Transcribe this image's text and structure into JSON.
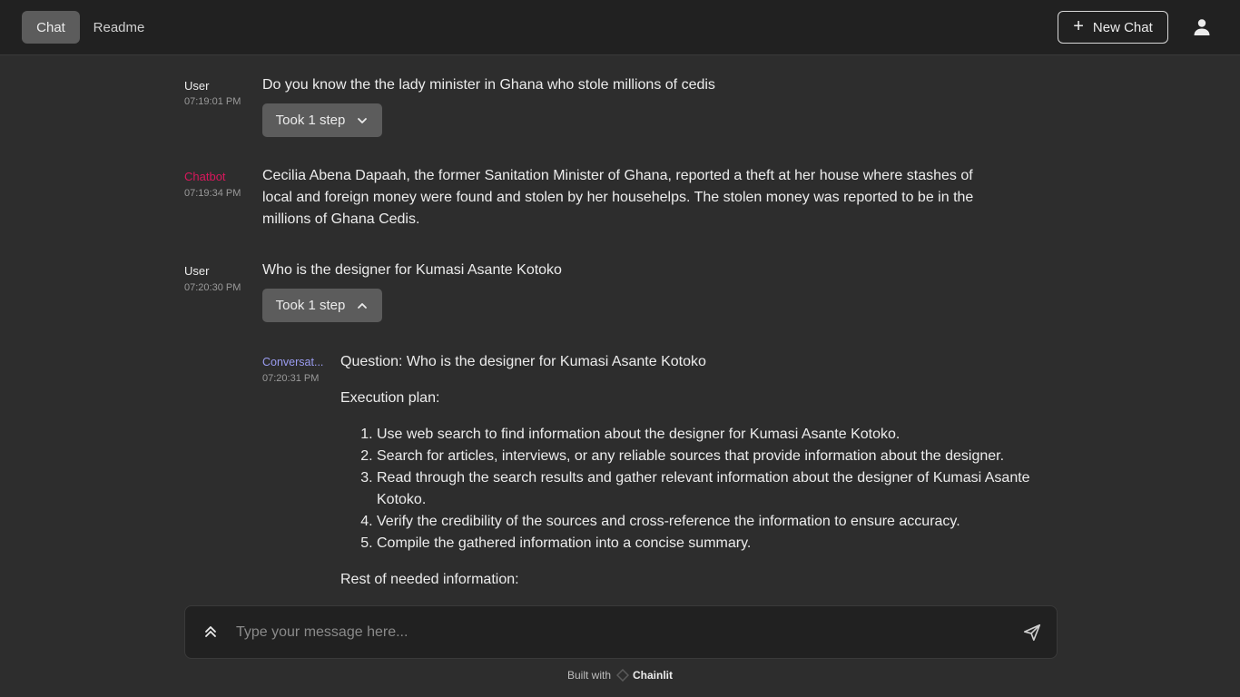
{
  "header": {
    "tabs": [
      {
        "label": "Chat",
        "active": true
      },
      {
        "label": "Readme",
        "active": false
      }
    ],
    "new_chat_label": "New Chat",
    "user_icon": "user-icon"
  },
  "messages": [
    {
      "author": "User",
      "time": "07:19:01 PM",
      "text": "Do you know the the lady minister in Ghana who stole millions of cedis",
      "step_label": "Took 1 step",
      "step_icon": "chevron-down-icon"
    },
    {
      "author": "Chatbot",
      "time": "07:19:34 PM",
      "text_lines": [
        "Cecilia Abena Dapaah, the former Sanitation Minister of Ghana, reported a theft at her house where stashes of",
        "local and foreign money were found and stolen by her househelps. The stolen money was reported to be in the",
        "millions of Ghana Cedis."
      ]
    },
    {
      "author": "User",
      "time": "07:20:30 PM",
      "text": "Who is the designer for Kumasi Asante Kotoko",
      "step_label": "Took 1 step",
      "step_icon": "chevron-up-icon"
    }
  ],
  "step": {
    "author": "Conversat...",
    "time": "07:20:31 PM",
    "question": "Question: Who is the designer for Kumasi Asante Kotoko",
    "plan_heading": "Execution plan:",
    "plan_items": [
      "Use web search to find information about the designer for Kumasi Asante Kotoko.",
      "Search for articles, interviews, or any reliable sources that provide information about the designer.",
      "Read through the search results and gather relevant information about the designer of Kumasi Asante Kotoko.",
      "Verify the credibility of the sources and cross-reference the information to ensure accuracy.",
      "Compile the gathered information into a concise summary."
    ],
    "rest_heading": "Rest of needed information:"
  },
  "composer": {
    "placeholder": "Type your message here...",
    "expand_icon": "chevrons-up-icon",
    "send_icon": "send-icon"
  },
  "footer": {
    "built_with": "Built with",
    "brand": "Chainlit"
  }
}
